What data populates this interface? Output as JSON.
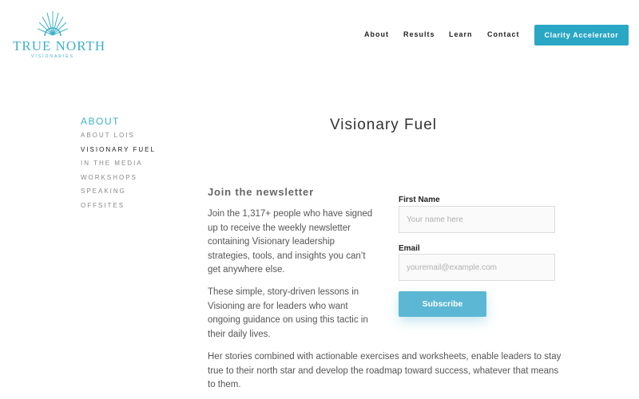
{
  "brand": {
    "name": "TRUE NORTH",
    "tagline": "VISIONARIES",
    "accent_color": "#2aa7c4"
  },
  "nav": {
    "items": [
      "About",
      "Results",
      "Learn",
      "Contact"
    ],
    "cta_label": "Clarity Accelerator"
  },
  "sidebar": {
    "heading": "ABOUT",
    "items": [
      {
        "label": "ABOUT LOIS",
        "active": false
      },
      {
        "label": "VISIONARY FUEL",
        "active": true
      },
      {
        "label": "IN THE MEDIA",
        "active": false
      },
      {
        "label": "WORKSHOPS",
        "active": false
      },
      {
        "label": "SPEAKING",
        "active": false
      },
      {
        "label": "OFFSITES",
        "active": false
      }
    ]
  },
  "main": {
    "title": "Visionary Fuel",
    "newsletter_heading": "Join the newsletter",
    "paragraphs": [
      "Join the 1,317+ people who have signed up to receive the weekly newsletter containing Visionary leadership strategies, tools, and insights you can’t get anywhere else.",
      "These simple, story-driven lessons in Visioning are for leaders who want ongoing guidance on using this tactic in their daily lives.",
      "Her stories combined with actionable exercises and worksheets, enable leaders to stay true to their north star and develop the roadmap toward success, whatever that means to them."
    ]
  },
  "form": {
    "first_name_label": "First Name",
    "first_name_placeholder": "Your name here",
    "first_name_value": "",
    "email_label": "Email",
    "email_placeholder": "youremail@example.com",
    "email_value": "",
    "submit_label": "Subscribe"
  }
}
